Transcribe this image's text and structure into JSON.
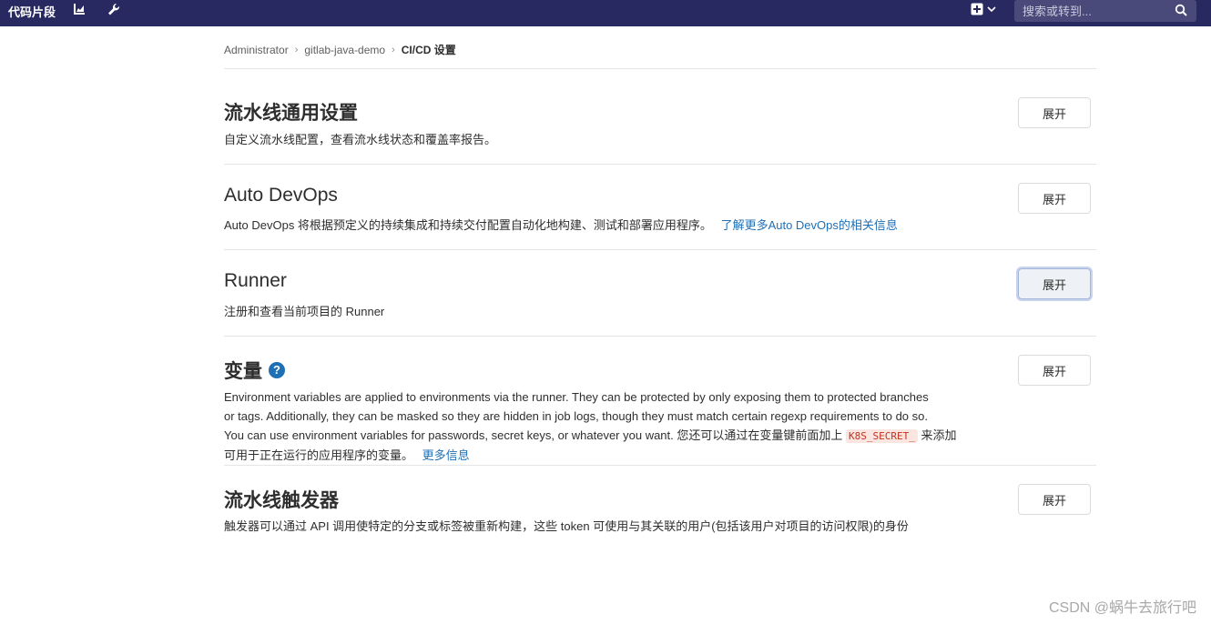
{
  "topbar": {
    "snippets_label": "代码片段",
    "search_placeholder": "搜索或转到..."
  },
  "breadcrumb": {
    "items": [
      "Administrator",
      "gitlab-java-demo"
    ],
    "current": "CI/CD 设置"
  },
  "sections": {
    "pipeline": {
      "title": "流水线通用设置",
      "desc": "自定义流水线配置，查看流水线状态和覆盖率报告。",
      "button": "展开"
    },
    "autodevops": {
      "title": "Auto DevOps",
      "desc": "Auto DevOps 将根据预定义的持续集成和持续交付配置自动化地构建、测试和部署应用程序。",
      "link": "了解更多Auto DevOps的相关信息",
      "button": "展开"
    },
    "runner": {
      "title": "Runner",
      "desc": "注册和查看当前项目的 Runner",
      "button": "展开"
    },
    "variables": {
      "title": "变量",
      "line1": "Environment variables are applied to environments via the runner. They can be protected by only exposing them to protected branches",
      "line2": "or tags. Additionally, they can be masked so they are hidden in job logs, though they must match certain regexp requirements to do so.",
      "line3": "You can use environment variables for passwords, secret keys, or whatever you want. 您还可以通过在变量键前面加上",
      "code": "K8S_SECRET_",
      "line3_end": "来添加",
      "line4": "可用于正在运行的应用程序的变量。",
      "link": "更多信息",
      "button": "展开"
    },
    "triggers": {
      "title": "流水线触发器",
      "desc": "触发器可以通过 API 调用使特定的分支或标签被重新构建，这些 token 可使用与其关联的用户(包括该用户对项目的访问权限)的身份",
      "button": "展开"
    }
  },
  "watermark": "CSDN @蜗牛去旅行吧",
  "colors": {
    "topbar": "#292961",
    "link": "#1f6fb5"
  }
}
